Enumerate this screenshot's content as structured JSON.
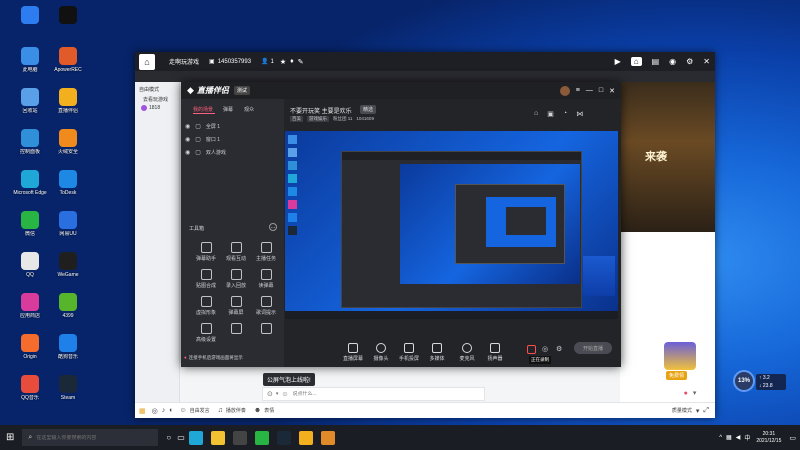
{
  "desktop": {
    "items": [
      {
        "label": "",
        "icon": "app-logo-icon",
        "color": "#2d7cf0"
      },
      {
        "label": "",
        "icon": "capcut-icon",
        "color": "#111111"
      },
      {
        "label": "此电脑",
        "icon": "computer-icon",
        "color": "#3a8ee6"
      },
      {
        "label": "ApowerREC",
        "icon": "record-icon",
        "color": "#e05a2a"
      },
      {
        "label": "回收站",
        "icon": "recycle-bin-icon",
        "color": "#5aa0e8"
      },
      {
        "label": "直播伴侣",
        "icon": "stream-icon",
        "color": "#f2b01e"
      },
      {
        "label": "控制面板",
        "icon": "control-panel-icon",
        "color": "#2f8fd8"
      },
      {
        "label": "火绒安全",
        "icon": "shield-icon",
        "color": "#f08a1c"
      },
      {
        "label": "Microsoft Edge",
        "icon": "edge-icon",
        "color": "#1fa7d8"
      },
      {
        "label": "ToDesk",
        "icon": "todesk-icon",
        "color": "#1e88e5"
      },
      {
        "label": "微信",
        "icon": "wechat-icon",
        "color": "#28b544"
      },
      {
        "label": "网易UU",
        "icon": "uu-icon",
        "color": "#2a6fe0"
      },
      {
        "label": "QQ",
        "icon": "qq-icon",
        "color": "#e7e7e7"
      },
      {
        "label": "WeGame",
        "icon": "wegame-icon",
        "color": "#1f1f1f"
      },
      {
        "label": "应用商店",
        "icon": "store-icon",
        "color": "#d83b9c"
      },
      {
        "label": "4399",
        "icon": "4399-icon",
        "color": "#57b52c"
      },
      {
        "label": "Origin",
        "icon": "origin-icon",
        "color": "#f56c2d"
      },
      {
        "label": "酷狗音乐",
        "icon": "kugou-icon",
        "color": "#1e80e8"
      },
      {
        "label": "QQ音乐",
        "icon": "qq-music-icon",
        "color": "#e84d3b"
      },
      {
        "label": "Steam",
        "icon": "steam-icon",
        "color": "#1b2838"
      }
    ]
  },
  "app": {
    "title": "走啊玩游戏",
    "id": "1450357993",
    "fans": "1",
    "left_tabs": [
      "自由模式",
      "去看玩游戏"
    ],
    "left_id": "1818",
    "banner_text": "来袭",
    "input_placeholder": "说点什么...",
    "bottom_left": [
      "自由发言",
      "播放伴奏",
      "表情"
    ],
    "bottom_right": "质量模式",
    "float_badge": "免费领",
    "percent": "13%",
    "speed_up": "3.2",
    "speed_down": "23.8"
  },
  "stream": {
    "title": "直播伴侣",
    "badge": "测试",
    "tabs": [
      "我的场景",
      "弹幕",
      "观众"
    ],
    "scenes": [
      "全屏 1",
      "窗口 1",
      "双人游戏"
    ],
    "tools_title": "工具箱",
    "tools": [
      "弹幕助手",
      "观看互动",
      "主播任务",
      "贴图合成",
      "录入回放",
      "读弹幕",
      "虚拟形象",
      "弹幕屏",
      "歌词提示",
      "高级设置",
      "",
      ""
    ],
    "notice": "连接手机后游戏画面将显示",
    "header_line1": "不要开玩笑 主要是欢乐",
    "header_badge": "精选",
    "header_line2": [
      "百美",
      "游戏娱乐",
      "粉丝团 11",
      "1041609"
    ],
    "controls": [
      "直播屏幕",
      "摄像头",
      "手机投屏",
      "多媒体",
      "麦克风",
      "扬声器"
    ],
    "start_button": "开始直播",
    "tooltip": "正在录制",
    "bubble": "公屏气泡上线啦!"
  },
  "taskbar": {
    "search_placeholder": "在这里输入你要搜索的内容",
    "time": "20:31",
    "date": "2021/12/15"
  },
  "colors": {
    "accent": "#2d7cf0",
    "taskbar": "#1b1d24",
    "stream_bg": "#2b2c31"
  }
}
